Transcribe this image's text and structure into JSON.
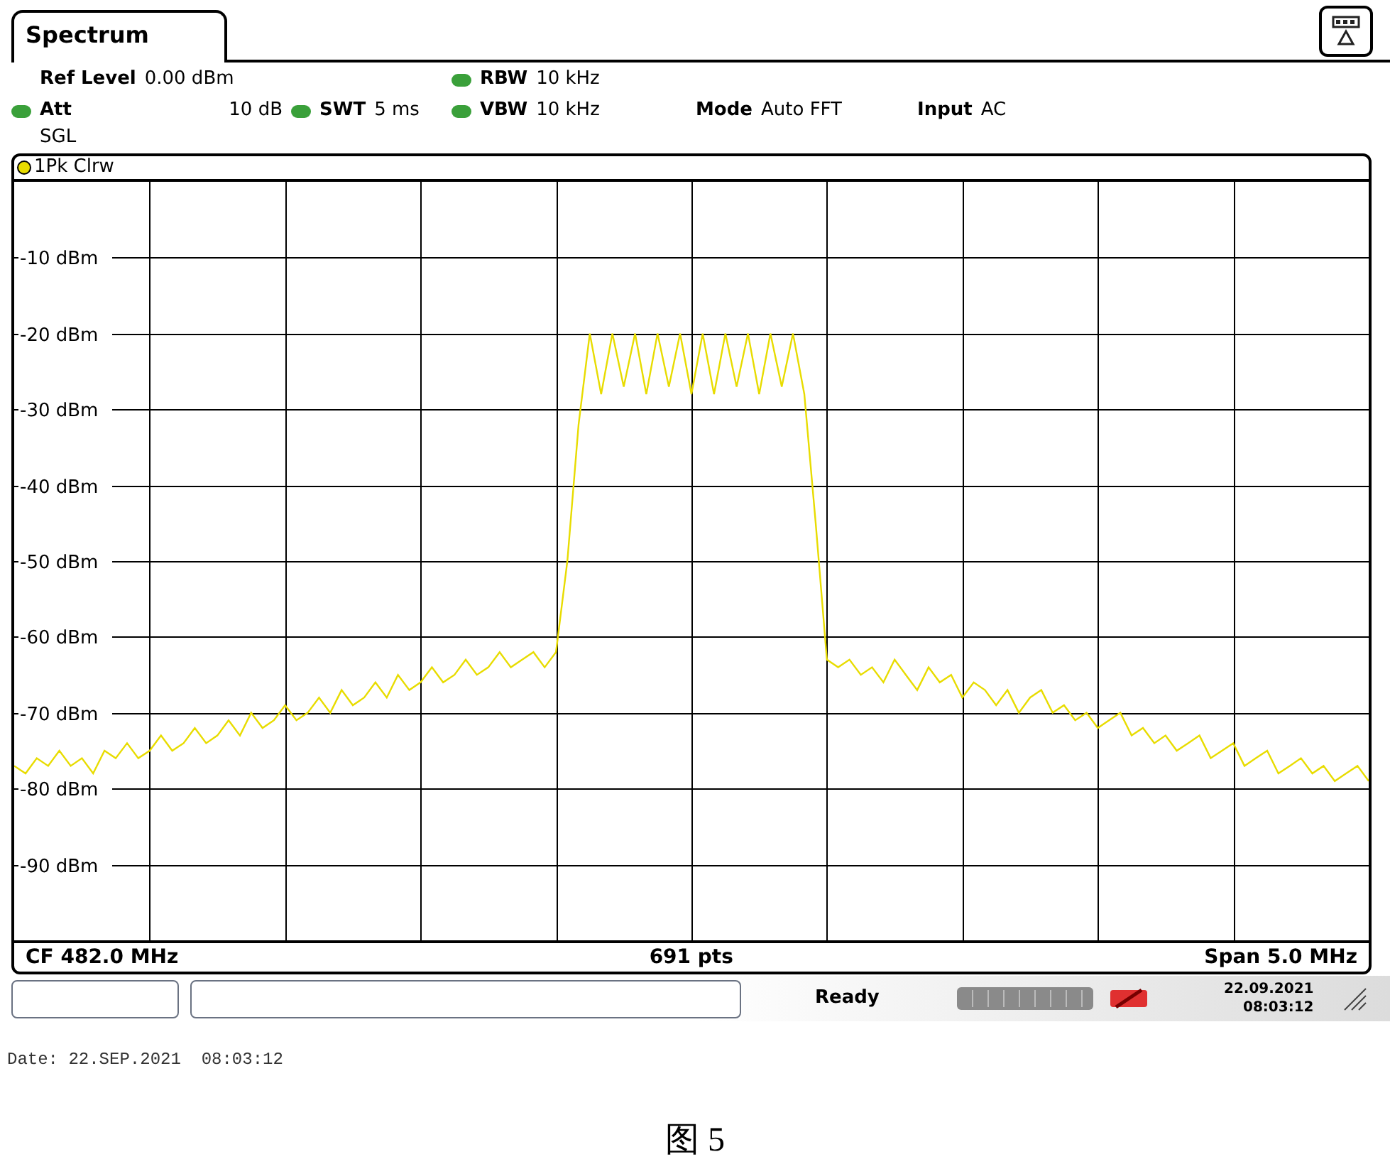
{
  "tab": {
    "label": "Spectrum",
    "selected": true
  },
  "settings": [
    [
      {
        "label": "Ref Level",
        "value": "0.00 dBm",
        "indicator": false
      },
      {
        "label": "RBW",
        "value": "10 kHz",
        "indicator": true
      }
    ],
    [
      {
        "label": "Att",
        "value": "10 dB",
        "indicator": true
      },
      {
        "label": "SWT",
        "value": "5 ms",
        "indicator": true
      },
      {
        "label": "VBW",
        "value": "10 kHz",
        "indicator": true
      },
      {
        "label": "Mode",
        "value": "Auto FFT",
        "indicator": false
      },
      {
        "label": "Input",
        "value": "AC",
        "indicator": false
      }
    ],
    [
      {
        "label": "SGL",
        "indicator": false
      }
    ]
  ],
  "chart_data": {
    "type": "line",
    "grid": true,
    "ylim": [
      -100,
      0
    ],
    "yticks": [
      {
        "value": -10,
        "label": "-10 dBm"
      },
      {
        "value": -20,
        "label": "-20 dBm"
      },
      {
        "value": -30,
        "label": "-30 dBm"
      },
      {
        "value": -40,
        "label": "-40 dBm"
      },
      {
        "value": -50,
        "label": "-50 dBm"
      },
      {
        "value": -60,
        "label": "-60 dBm"
      },
      {
        "value": -70,
        "label": "-70 dBm"
      },
      {
        "value": -80,
        "label": "-80 dBm"
      },
      {
        "value": -90,
        "label": "-90 dBm"
      }
    ],
    "categories": [
      null,
      null,
      null,
      null,
      null,
      null,
      null,
      null,
      null,
      null,
      null,
      null,
      null,
      null,
      null,
      null,
      null,
      null,
      null,
      null,
      null,
      null,
      null,
      null,
      null,
      null,
      null,
      null,
      null,
      null,
      null,
      null,
      null,
      null,
      null,
      null,
      null,
      null,
      null,
      null,
      null,
      null,
      null,
      null,
      null,
      null,
      null,
      null,
      null,
      null,
      null,
      null,
      null,
      null,
      null,
      null,
      null,
      null,
      null,
      null,
      null,
      null,
      null,
      null,
      null,
      null,
      null,
      null,
      null,
      null,
      null,
      null,
      null,
      null,
      null,
      null,
      null,
      null,
      null,
      null,
      null,
      null,
      null,
      null,
      null,
      null,
      null,
      null,
      null,
      null,
      null,
      null,
      null,
      null,
      null,
      null,
      null,
      null,
      null,
      null,
      null,
      null,
      null,
      null,
      null,
      null,
      null,
      null,
      null,
      null,
      null,
      null,
      null,
      null,
      null,
      null,
      null,
      null,
      null,
      null,
      null
    ],
    "series": [
      {
        "name": "1Pk Clrw",
        "color": "#e8dc00",
        "values": [
          -77,
          -78,
          -76,
          -77,
          -75,
          -77,
          -76,
          -78,
          -75,
          -76,
          -74,
          -76,
          -75,
          -73,
          -75,
          -74,
          -72,
          -74,
          -73,
          -71,
          -73,
          -70,
          -72,
          -71,
          -69,
          -71,
          -70,
          -68,
          -70,
          -67,
          -69,
          -68,
          -66,
          -68,
          -65,
          -67,
          -66,
          -64,
          -66,
          -65,
          -63,
          -65,
          -64,
          -62,
          -64,
          -63,
          -62,
          -64,
          -62,
          -50,
          -32,
          -20,
          -28,
          -20,
          -27,
          -20,
          -28,
          -20,
          -27,
          -20,
          -28,
          -20,
          -28,
          -20,
          -27,
          -20,
          -28,
          -20,
          -27,
          -20,
          -28,
          -45,
          -63,
          -64,
          -63,
          -65,
          -64,
          -66,
          -63,
          -65,
          -67,
          -64,
          -66,
          -65,
          -68,
          -66,
          -67,
          -69,
          -67,
          -70,
          -68,
          -67,
          -70,
          -69,
          -71,
          -70,
          -72,
          -71,
          -70,
          -73,
          -72,
          -74,
          -73,
          -75,
          -74,
          -73,
          -76,
          -75,
          -74,
          -77,
          -76,
          -75,
          -78,
          -77,
          -76,
          -78,
          -77,
          -79,
          -78,
          -77,
          -79
        ]
      }
    ]
  },
  "footer": {
    "center_frequency": "CF 482.0 MHz",
    "points": "691 pts",
    "span": "Span 5.0 MHz"
  },
  "status_bar": {
    "status": "Ready",
    "date": "22.09.2021",
    "time": "08:03:12"
  },
  "print_stamp": "Date: 22.SEP.2021  08:03:12",
  "caption": "图 5"
}
